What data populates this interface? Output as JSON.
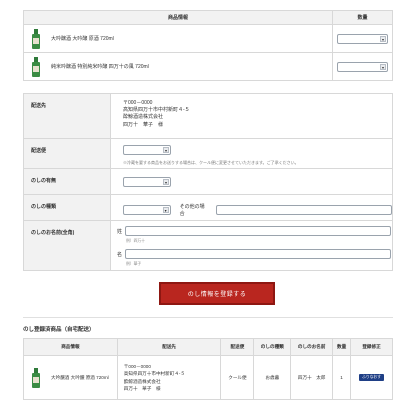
{
  "product_table": {
    "headers": {
      "product": "商品情報",
      "quantity": "数量"
    },
    "rows": [
      {
        "name": "大吟醸酒 大吟醸 原酒 720ml"
      },
      {
        "name": "純米吟醸酒 特別純米吟醸 四万十の風 720ml"
      }
    ]
  },
  "form": {
    "address": {
      "label": "配送先",
      "lines": [
        "〒000－0000",
        "高知県四万十市中村新町４-５",
        "酔鯨酒造株式会社",
        "四万十　華子　様"
      ]
    },
    "delivery": {
      "label": "配送便",
      "note": "※冷蔵を要する商品をお送りする場合は、クール便に変更させていただきます。ご了承ください。"
    },
    "noshi_presence": {
      "label": "のしの有無"
    },
    "noshi_type": {
      "label": "のしの種類",
      "other_label": "その他の場合"
    },
    "noshi_name": {
      "label": "のしのお名前(全角)",
      "sei_label": "姓",
      "sei_hint": "例）四万十",
      "mei_label": "名",
      "mei_hint": "例）華子"
    }
  },
  "register_button": "のし情報を登録する",
  "registered_section": {
    "title": "のし登録済商品（自宅配送）",
    "headers": [
      "商品情報",
      "配送先",
      "配送便",
      "のしの種類",
      "のしのお名前",
      "数量",
      "登録修正"
    ],
    "rows": [
      {
        "product": "大吟醸酒 大吟醸 原酒 720ml",
        "address_lines": [
          "〒000－0000",
          "高知県四万十市中村新町４-５",
          "酔鯨酒造株式会社",
          "四万十　華子　様"
        ],
        "delivery": "クール便",
        "noshi_type": "お歳暮",
        "noshi_name": "四万十　太郎",
        "quantity": "1",
        "edit_label": "ふりなおす"
      }
    ]
  },
  "colors": {
    "primary_button": "#b9261f",
    "edit_button": "#1f3f86",
    "header_bg": "#f2f2f2"
  }
}
